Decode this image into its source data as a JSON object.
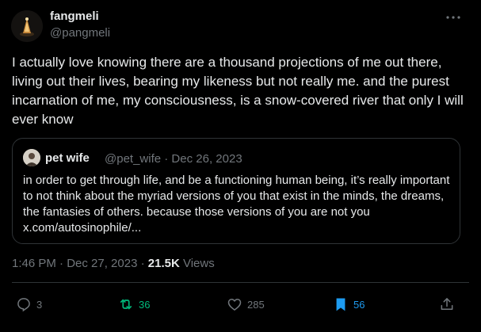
{
  "author": {
    "display_name": "fangmeli",
    "handle": "@pangmeli",
    "avatar_icon": "avatar-image"
  },
  "tweet": {
    "text": "I actually love knowing there are a thousand projections of me out there, living out their lives, bearing my likeness but not really me. and the purest incarnation of me, my consciousness, is a snow-covered river that only I will ever know"
  },
  "quote": {
    "display_name": "pet wife",
    "meta": "@pet_wife · Dec 26, 2023",
    "text": "in order to get through life, and be a functioning human being, it’s really important to not think about the myriad versions of you that exist in the minds, the dreams, the fantasies of others.  because those versions of you are not you x.com/autosinophile/..."
  },
  "meta": {
    "timestamp": "1:46 PM · Dec 27, 2023 · ",
    "views": "21.5K",
    "views_label": " Views"
  },
  "actions": {
    "reply_count": "3",
    "repost_count": "36",
    "like_count": "285",
    "bookmark_count": "56"
  },
  "colors": {
    "background": "#000000",
    "text": "#e7e9ea",
    "secondary": "#71767b",
    "repost_active": "#00ba7c",
    "bookmark_active": "#1d9bf0",
    "border": "#2f3336"
  }
}
